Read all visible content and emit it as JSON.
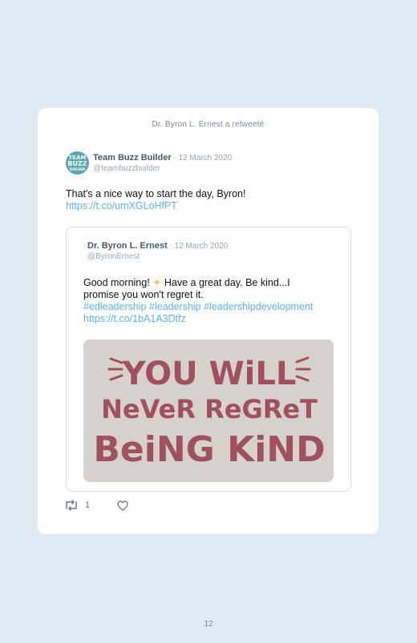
{
  "retweet_notice": "Dr. Byron L. Ernest a retweeté",
  "tweet": {
    "avatar_lines": [
      "TEAM",
      "BUZZ",
      "BUILDER"
    ],
    "author_name": "Team Buzz Builder",
    "date": " · 12 March 2020",
    "handle": "@teambuzzbuilder",
    "text": "That's a nice way to start the day, Byron!",
    "link": "https://t.co/umXGLoHfPT"
  },
  "quoted_tweet": {
    "author_name": "Dr. Byron L. Ernest",
    "date": " · 12 March 2020",
    "handle": "@ByronErnest",
    "text_part1": "Good morning! ",
    "emoji": "☀",
    "text_part2": " Have a great day. Be kind...I promise you won't regret it.",
    "hashtags": "#edleadership #leadership #leadershipdevelopment",
    "link": "https://t.co/1bA1A3Dtfz",
    "image_text": [
      "YOU WiLL",
      "NeVeR ReGReT",
      "BeiNG KiND"
    ],
    "image_text_color": "#a0505f"
  },
  "actions": {
    "retweet_icon": "retweet-icon",
    "retweet_count": "1",
    "like_icon": "heart-icon"
  },
  "page_number": "12"
}
